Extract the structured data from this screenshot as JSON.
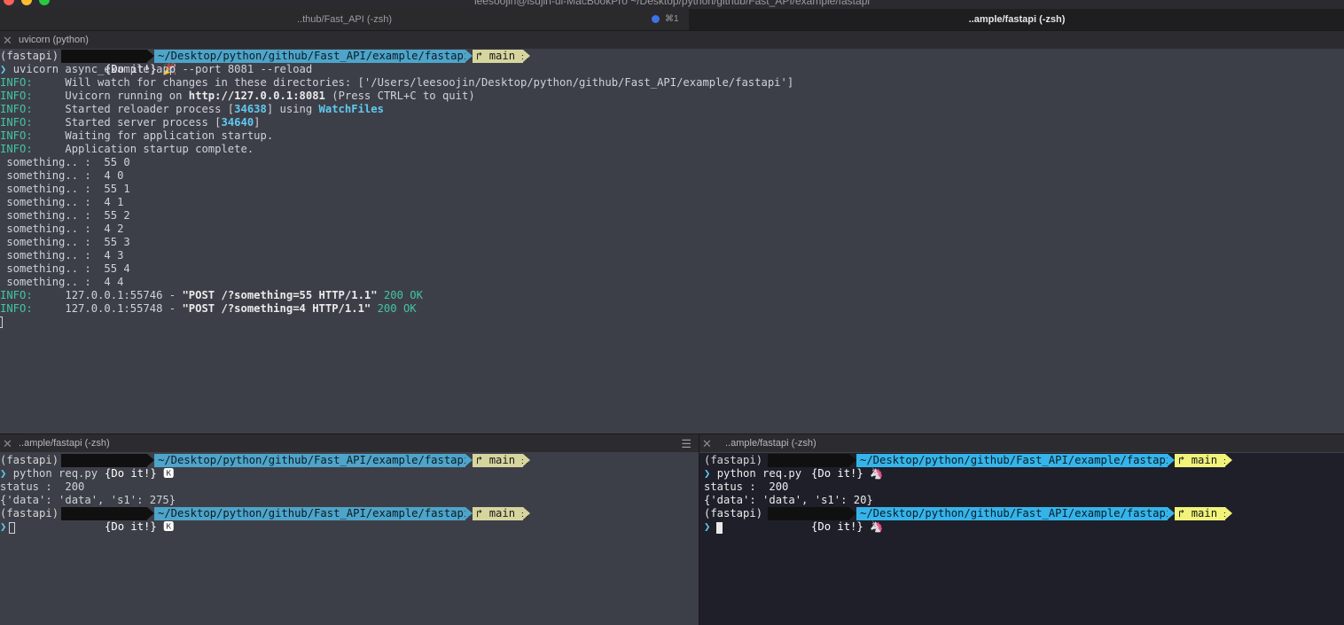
{
  "window": {
    "title": "leesoojin@isujin-ui-MacBookPro ~/Desktop/python/github/Fast_API/example/fastapi",
    "tabs": [
      {
        "label": "..thub/Fast_API (-zsh)",
        "shortcut": "⌘1"
      },
      {
        "label": "..ample/fastapi (-zsh)"
      }
    ]
  },
  "colors": {
    "accent_info": "#41c6a1",
    "accent_cyan": "#60c9f0",
    "path_bg": "#4ea4c9",
    "git_bg": "#d6d59e",
    "active_pane_bg": "#1e1f29",
    "tab_dot": "#3d72e8"
  },
  "top_pane": {
    "header": "uvicorn (python)",
    "prompt": {
      "env": "(fastapi)",
      "doit": "{Do it!}",
      "icon": "🎉",
      "path": "~/Desktop/python/github/Fast_API/example/fastapi",
      "branch_icon": "branch-icon",
      "branch": "main ±"
    },
    "command": "uvicorn async_example:app --port 8081 --reload",
    "info_label": "INFO:",
    "log": [
      {
        "pre": "Will watch for changes in these directories: ['/Users/leesoojin/Desktop/python/github/Fast_API/example/fastapi']"
      },
      {
        "pre": "Uvicorn running on ",
        "bold": "http://127.0.0.1:8081",
        "post": " (Press CTRL+C to quit)"
      },
      {
        "pre": "Started reloader process [",
        "cyan": "34638",
        "mid": "] using ",
        "cyan2": "WatchFiles"
      },
      {
        "pre": "Started server process [",
        "cyan": "34640",
        "post": "]"
      },
      {
        "pre": "Waiting for application startup."
      },
      {
        "pre": "Application startup complete."
      }
    ],
    "something": [
      " something.. :  55 0",
      " something.. :  4 0",
      " something.. :  55 1",
      " something.. :  4 1",
      " something.. :  55 2",
      " something.. :  4 2",
      " something.. :  55 3",
      " something.. :  4 3",
      " something.. :  55 4",
      " something.. :  4 4"
    ],
    "requests": [
      {
        "addr": "127.0.0.1:55746 - ",
        "req": "\"POST /?something=55 HTTP/1.1\"",
        "status": "200 OK"
      },
      {
        "addr": "127.0.0.1:55748 - ",
        "req": "\"POST /?something=4 HTTP/1.1\"",
        "status": "200 OK"
      }
    ]
  },
  "bottom_left_pane": {
    "header": "..ample/fastapi (-zsh)",
    "menu_icon": "hamburger-icon",
    "prompt": {
      "env": "(fastapi)",
      "doit": "{Do it!}",
      "icon": "🅺",
      "path": "~/Desktop/python/github/Fast_API/example/fastapi",
      "branch": "main ±"
    },
    "command": "python req.py",
    "output": [
      "status :  200",
      "{'data': 'data', 's1': 275}"
    ]
  },
  "bottom_right_pane": {
    "header": "..ample/fastapi (-zsh)",
    "prompt": {
      "env": "(fastapi)",
      "doit": "{Do it!}",
      "icon": "🦄",
      "path": "~/Desktop/python/github/Fast_API/example/fastapi",
      "branch": "main ±"
    },
    "command": "python req.py",
    "output": [
      "status :  200",
      "{'data': 'data', 's1': 20}"
    ]
  }
}
